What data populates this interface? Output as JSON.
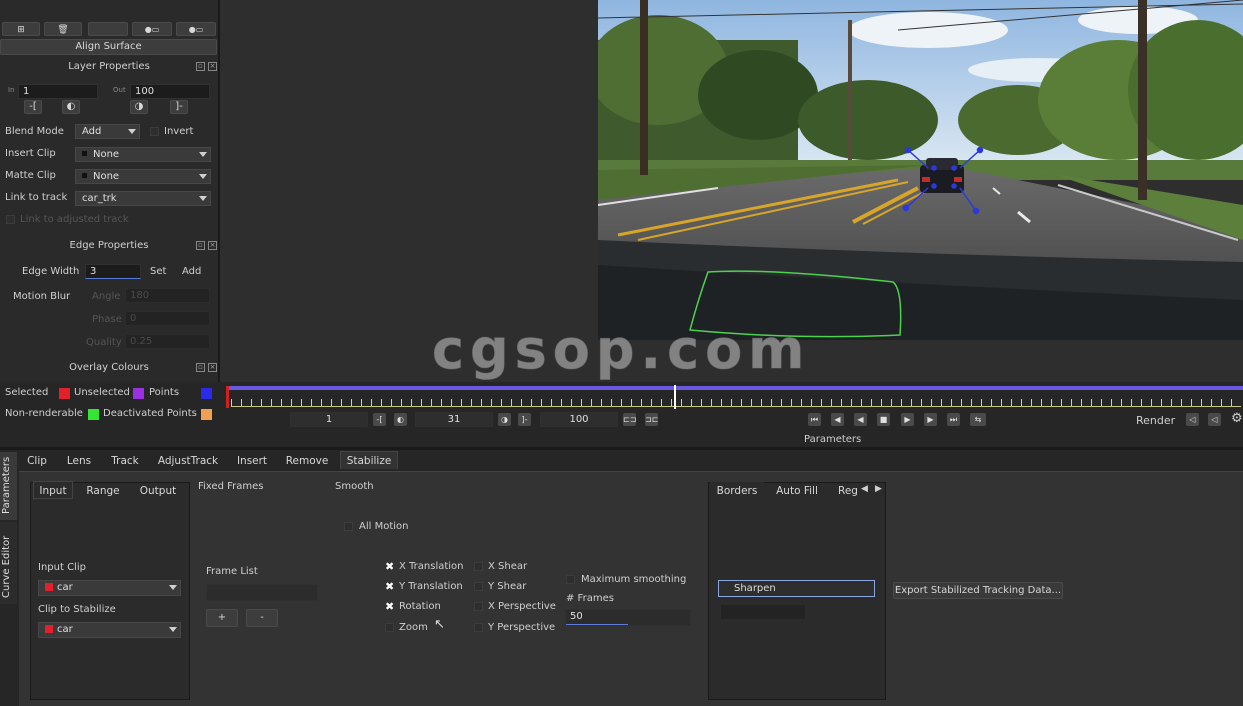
{
  "top_left": {
    "toolbar_icons": [
      "add-layer-icon",
      "delete-layer-icon",
      "blank-icon",
      "layer-options-icon",
      "layer-options-2-icon"
    ],
    "align_surface_label": "Align Surface"
  },
  "layer_properties": {
    "title": "Layer Properties",
    "in_label": "In",
    "in_value": "1",
    "out_label": "Out",
    "out_value": "100",
    "bracket_left": "-[",
    "bracket_right": "]-",
    "blend_mode_label": "Blend Mode",
    "blend_mode_value": "Add",
    "invert_label": "Invert",
    "insert_clip_label": "Insert Clip",
    "insert_clip_value": "None",
    "matte_clip_label": "Matte Clip",
    "matte_clip_value": "None",
    "link_track_label": "Link to track",
    "link_track_value": "car_trk",
    "link_adjusted_label": "Link to adjusted track"
  },
  "edge_properties": {
    "title": "Edge Properties",
    "edge_width_label": "Edge Width",
    "edge_width_value": "3",
    "set_label": "Set",
    "add_label": "Add",
    "motion_blur_label": "Motion Blur",
    "angle_label": "Angle",
    "angle_value": "180",
    "phase_label": "Phase",
    "phase_value": "0",
    "quality_label": "Quality",
    "quality_value": "0.25"
  },
  "overlay_colours": {
    "title": "Overlay Colours",
    "selected_label": "Selected",
    "unselected_label": "Unselected",
    "points_label": "Points",
    "nonrenderable_label": "Non-renderable",
    "deactivated_label": "Deactivated Points",
    "colors": {
      "selected": "#e0202a",
      "unselected": "#9b30e0",
      "points": "#2a2ae8",
      "nonrenderable": "#33e633",
      "deactivated": "#f0a050"
    }
  },
  "watermark": "cgsop.com",
  "timeline": {
    "start_frame": "1",
    "current_frame": "31",
    "end_frame": "100",
    "render_label": "Render",
    "parameters_label": "Parameters",
    "playhead_fraction": 0.44,
    "accent_color": "#6a5adf"
  },
  "side_tabs": [
    "Parameters",
    "Curve Editor"
  ],
  "tabs": [
    "Clip",
    "Lens",
    "Track",
    "AdjustTrack",
    "Insert",
    "Remove",
    "Stabilize"
  ],
  "active_tab": "Stabilize",
  "stabilize": {
    "subtabs": [
      "Input",
      "Range",
      "Output"
    ],
    "input_clip_label": "Input Clip",
    "input_clip_value": "car",
    "clip_stabilize_label": "Clip to Stabilize",
    "clip_stabilize_value": "car",
    "fixed_frames_label": "Fixed Frames",
    "frame_list_label": "Frame List",
    "plus_label": "+",
    "minus_label": "-",
    "smooth_label": "Smooth",
    "all_motion_label": "All Motion",
    "x_translation_label": "X Translation",
    "y_translation_label": "Y Translation",
    "rotation_label": "Rotation",
    "zoom_label": "Zoom",
    "x_shear_label": "X Shear",
    "y_shear_label": "Y Shear",
    "x_perspective_label": "X Perspective",
    "y_perspective_label": "Y Perspective",
    "max_smoothing_label": "Maximum smoothing",
    "frames_label": "# Frames",
    "frames_value": "50",
    "right_tabs": [
      "Borders",
      "Auto Fill",
      "Reg"
    ],
    "sharpen_label": "Sharpen",
    "export_label": "Export Stabilized Tracking Data..."
  }
}
